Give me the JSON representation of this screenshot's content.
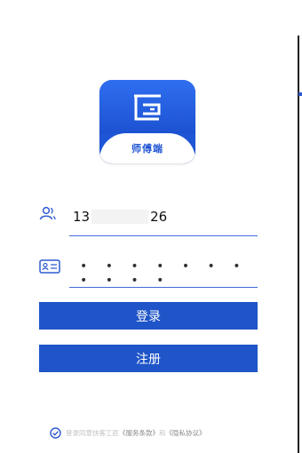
{
  "app": {
    "logo_text": "师傅端"
  },
  "login": {
    "phone_prefix": "13",
    "phone_suffix": "26",
    "password_mask": "• • • • • • • • • • •",
    "login_button": "登录",
    "register_button": "注册"
  },
  "agreement": {
    "prefix": "登录同意快客工匠",
    "terms": "《服务条款》",
    "and": " 和 ",
    "privacy": "《隐私协议》"
  },
  "colors": {
    "primary": "#1f55c8",
    "logo_blue": "#2f6ff0"
  }
}
